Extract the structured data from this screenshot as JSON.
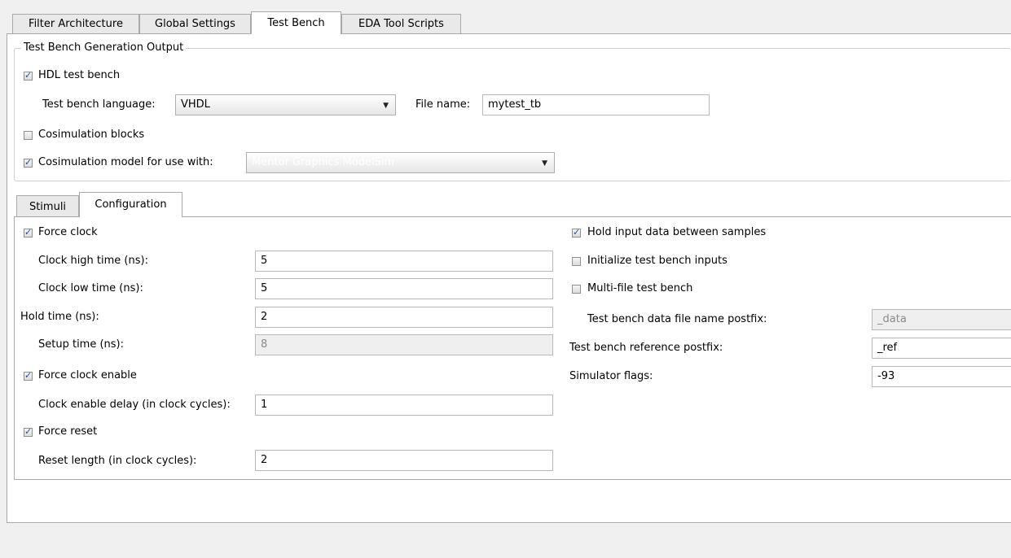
{
  "tabs": [
    "Filter Architecture",
    "Global Settings",
    "Test Bench",
    "EDA Tool Scripts"
  ],
  "group": {
    "title": "Test Bench Generation Output",
    "hdl_test_bench": {
      "label": "HDL test bench",
      "checked": true
    },
    "language_label": "Test bench language:",
    "language_value": "VHDL",
    "file_name_label": "File name:",
    "file_name_value": "mytest_tb",
    "cosim_blocks": {
      "label": "Cosimulation blocks",
      "checked": false
    },
    "cosim_model": {
      "label": "Cosimulation model for use with:",
      "checked": true
    },
    "cosim_model_value": "Mentor Graphics ModelSim"
  },
  "inner_tabs": [
    "Stimuli",
    "Configuration"
  ],
  "config": {
    "force_clock": {
      "label": "Force clock",
      "checked": true
    },
    "clock_high_label": "Clock high time (ns):",
    "clock_high_value": "5",
    "clock_low_label": "Clock low time (ns):",
    "clock_low_value": "5",
    "hold_time_label": "Hold time (ns):",
    "hold_time_value": "2",
    "setup_time_label": "Setup time (ns):",
    "setup_time_value": "8",
    "force_clock_enable": {
      "label": "Force clock enable",
      "checked": true
    },
    "clock_enable_delay_label": "Clock enable delay (in clock cycles):",
    "clock_enable_delay_value": "1",
    "force_reset": {
      "label": "Force reset",
      "checked": true
    },
    "reset_length_label": "Reset length (in clock cycles):",
    "reset_length_value": "2",
    "hold_input": {
      "label": "Hold input data between samples",
      "checked": true
    },
    "init_inputs": {
      "label": "Initialize test bench inputs",
      "checked": false
    },
    "multi_file": {
      "label": "Multi-file test bench",
      "checked": false
    },
    "data_postfix_label": "Test bench data file name postfix:",
    "data_postfix_value": "_data",
    "ref_postfix_label": "Test bench reference postfix:",
    "ref_postfix_value": "_ref",
    "sim_flags_label": "Simulator flags:",
    "sim_flags_value": "-93"
  }
}
